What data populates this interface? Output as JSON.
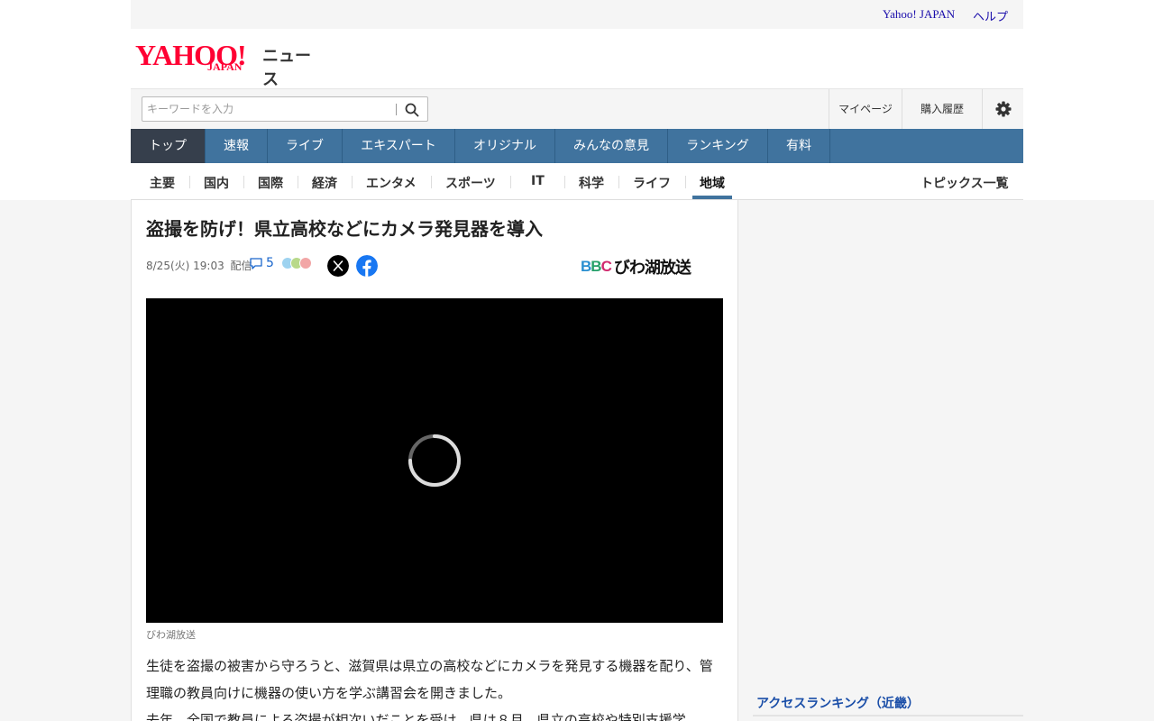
{
  "header": {
    "links": [
      "Yahoo! JAPAN",
      "ヘルプ"
    ],
    "logo_text": "YAHOO!",
    "logo_sub": "JAPAN",
    "section": "ニュース"
  },
  "search": {
    "placeholder": "キーワードを入力",
    "mypage": "マイページ",
    "history": "購入履歴"
  },
  "global_nav": [
    "トップ",
    "速報",
    "ライブ",
    "エキスパート",
    "オリジナル",
    "みんなの意見",
    "ランキング",
    "有料"
  ],
  "sub_nav": {
    "items": [
      "主要",
      "国内",
      "国際",
      "経済",
      "エンタメ",
      "スポーツ",
      "IT",
      "科学",
      "ライフ",
      "地域"
    ],
    "active": "地域",
    "topics": "トピックス一覧"
  },
  "article": {
    "title": "盗撮を防げ！県立高校などにカメラ発見器を導入",
    "date": "8/25(火) 19:03",
    "delivered": "配信",
    "comment_count": "5",
    "publisher_logo": "BBC",
    "publisher_name": "びわ湖放送",
    "video_caption": "びわ湖放送",
    "paragraphs": [
      "生徒を盗撮の被害から守ろうと、滋賀県は県立の高校などにカメラを発見する機器を配り、管理職の教員向けに機器の使い方を学ぶ講習会を開きました。",
      "去年、全国で教員による盗撮が相次いだことを受け、県は８月、県立の高校や特別支援学"
    ]
  },
  "sidebar": {
    "ranking_title": "アクセスランキング（近畿）"
  },
  "colors": {
    "nav_bg": "#40739e",
    "nav_active": "#363f4c",
    "logo_red": "#ff0033"
  }
}
